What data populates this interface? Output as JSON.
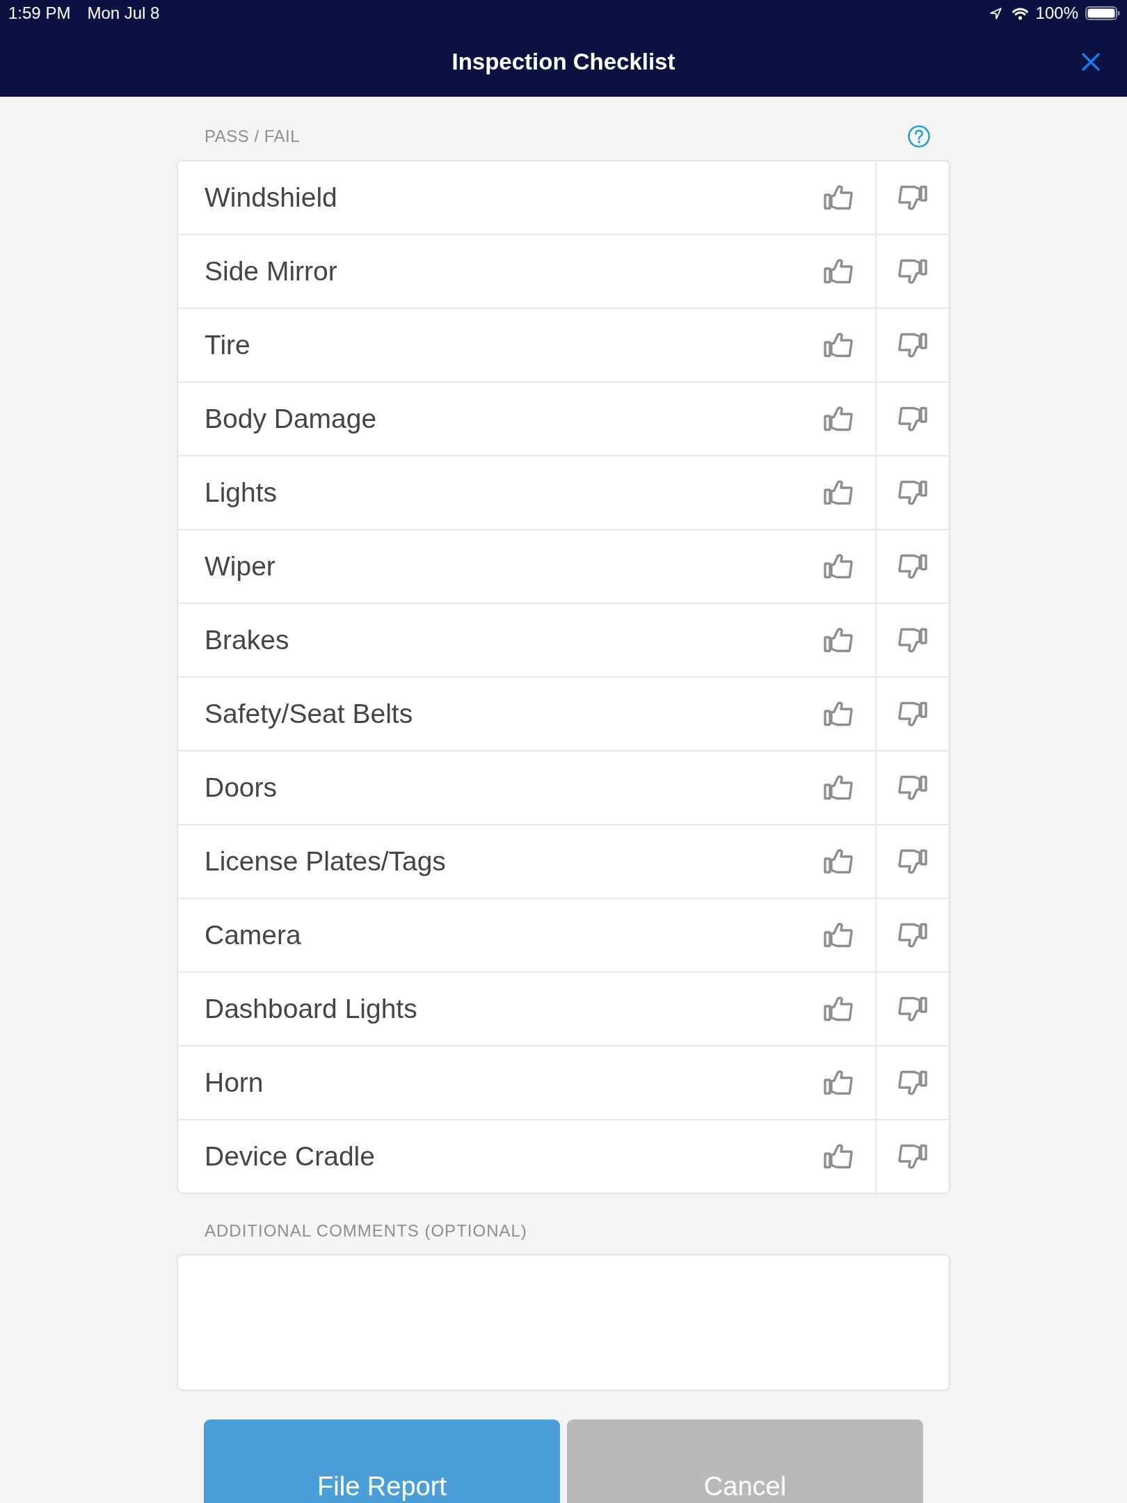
{
  "status_bar": {
    "time": "1:59 PM",
    "date": "Mon Jul 8",
    "battery": "100%"
  },
  "header": {
    "title": "Inspection Checklist"
  },
  "checklist": {
    "heading": "PASS / FAIL",
    "items": [
      {
        "label": "Windshield",
        "pass_selected": false,
        "fail_selected": false
      },
      {
        "label": "Side Mirror",
        "pass_selected": false,
        "fail_selected": false
      },
      {
        "label": "Tire",
        "pass_selected": false,
        "fail_selected": false
      },
      {
        "label": "Body Damage",
        "pass_selected": false,
        "fail_selected": false
      },
      {
        "label": "Lights",
        "pass_selected": false,
        "fail_selected": false
      },
      {
        "label": "Wiper",
        "pass_selected": false,
        "fail_selected": false
      },
      {
        "label": "Brakes",
        "pass_selected": false,
        "fail_selected": false
      },
      {
        "label": "Safety/Seat Belts",
        "pass_selected": false,
        "fail_selected": false
      },
      {
        "label": "Doors",
        "pass_selected": false,
        "fail_selected": false
      },
      {
        "label": "License Plates/Tags",
        "pass_selected": false,
        "fail_selected": false
      },
      {
        "label": "Camera",
        "pass_selected": false,
        "fail_selected": false
      },
      {
        "label": "Dashboard Lights",
        "pass_selected": false,
        "fail_selected": false
      },
      {
        "label": "Horn",
        "pass_selected": false,
        "fail_selected": false
      },
      {
        "label": "Device Cradle",
        "pass_selected": false,
        "fail_selected": false
      }
    ]
  },
  "comments": {
    "label": "ADDITIONAL COMMENTS (OPTIONAL)"
  },
  "buttons": [
    {
      "kind": "primary",
      "label": "File Report"
    },
    {
      "kind": "secondary",
      "label": "Cancel"
    }
  ]
}
